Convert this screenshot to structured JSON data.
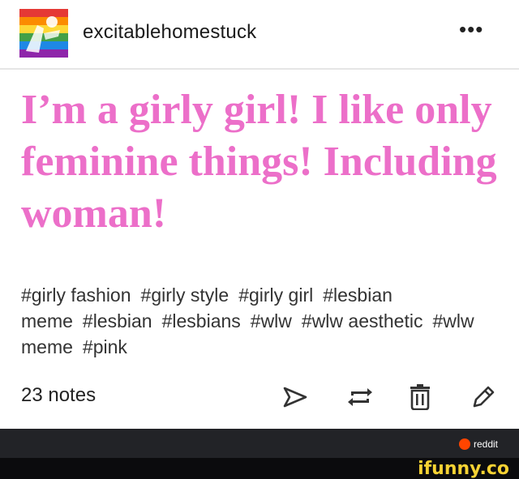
{
  "post": {
    "username": "excitablehomestuck",
    "headline": "I’m a girly girl! I like only feminine things! Including woman!",
    "tags": [
      "#girly fashion",
      "#girly style",
      "#girly girl",
      "#lesbian meme",
      "#lesbian",
      "#lesbians",
      "#wlw",
      "#wlw aesthetic",
      "#wlw meme",
      "#pink"
    ],
    "notes": "23 notes"
  },
  "icons": {
    "more": "ellipsis-icon",
    "send": "send-icon",
    "reblog": "reblog-icon",
    "delete": "trash-icon",
    "edit": "pencil-icon"
  },
  "watermark": {
    "reddit": "reddit",
    "ifunny": "ifunny.co"
  },
  "colors": {
    "headline": "#ec6fc9",
    "footer": "#222327",
    "ifunny": "#f7d233",
    "reddit": "#ff4500"
  }
}
